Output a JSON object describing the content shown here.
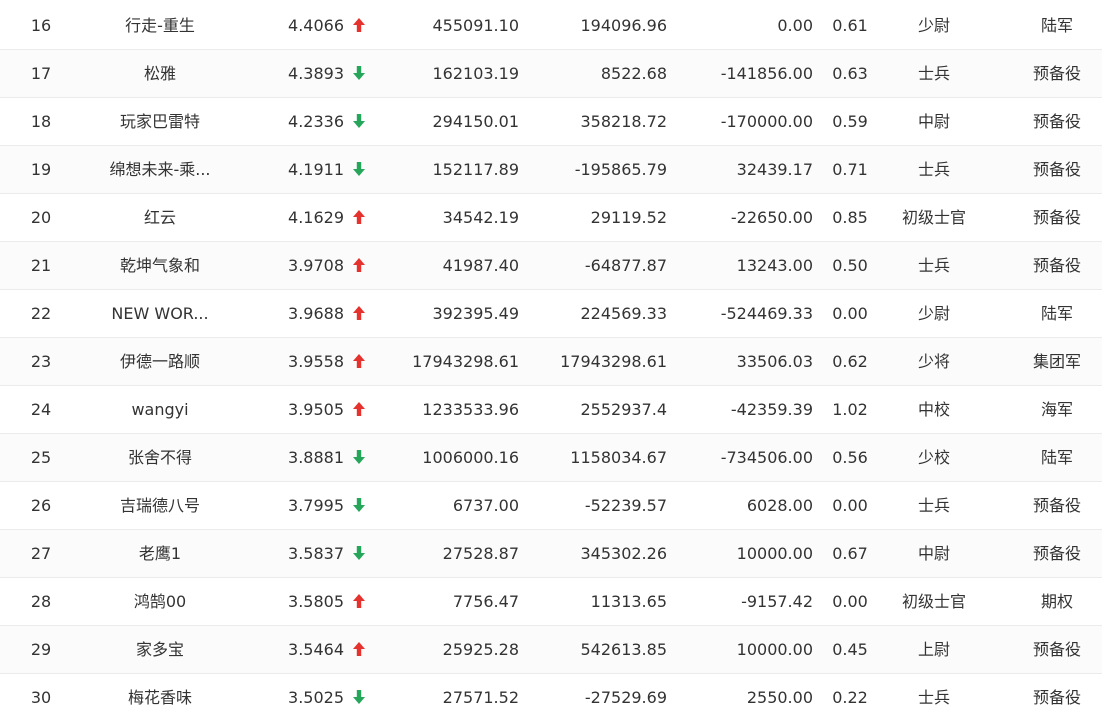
{
  "colors": {
    "up": "#e5322d",
    "down": "#26a65b"
  },
  "rows": [
    {
      "rank": "16",
      "name": "行走-重生",
      "score": "4.4066",
      "trend": "up",
      "v1": "455091.10",
      "v2": "194096.96",
      "v3": "0.00",
      "v4": "0.61",
      "title": "少尉",
      "branch": "陆军"
    },
    {
      "rank": "17",
      "name": "松雅",
      "score": "4.3893",
      "trend": "down",
      "v1": "162103.19",
      "v2": "8522.68",
      "v3": "-141856.00",
      "v4": "0.63",
      "title": "士兵",
      "branch": "预备役"
    },
    {
      "rank": "18",
      "name": "玩家巴雷特",
      "score": "4.2336",
      "trend": "down",
      "v1": "294150.01",
      "v2": "358218.72",
      "v3": "-170000.00",
      "v4": "0.59",
      "title": "中尉",
      "branch": "预备役"
    },
    {
      "rank": "19",
      "name": "绵想未来-乘...",
      "score": "4.1911",
      "trend": "down",
      "v1": "152117.89",
      "v2": "-195865.79",
      "v3": "32439.17",
      "v4": "0.71",
      "title": "士兵",
      "branch": "预备役"
    },
    {
      "rank": "20",
      "name": "红云",
      "score": "4.1629",
      "trend": "up",
      "v1": "34542.19",
      "v2": "29119.52",
      "v3": "-22650.00",
      "v4": "0.85",
      "title": "初级士官",
      "branch": "预备役"
    },
    {
      "rank": "21",
      "name": "乾坤气象和",
      "score": "3.9708",
      "trend": "up",
      "v1": "41987.40",
      "v2": "-64877.87",
      "v3": "13243.00",
      "v4": "0.50",
      "title": "士兵",
      "branch": "预备役"
    },
    {
      "rank": "22",
      "name": "NEW WOR...",
      "score": "3.9688",
      "trend": "up",
      "v1": "392395.49",
      "v2": "224569.33",
      "v3": "-524469.33",
      "v4": "0.00",
      "title": "少尉",
      "branch": "陆军"
    },
    {
      "rank": "23",
      "name": "伊德一路顺",
      "score": "3.9558",
      "trend": "up",
      "v1": "17943298.61",
      "v2": "17943298.61",
      "v3": "33506.03",
      "v4": "0.62",
      "title": "少将",
      "branch": "集团军"
    },
    {
      "rank": "24",
      "name": "wangyi",
      "score": "3.9505",
      "trend": "up",
      "v1": "1233533.96",
      "v2": "2552937.4",
      "v3": "-42359.39",
      "v4": "1.02",
      "title": "中校",
      "branch": "海军"
    },
    {
      "rank": "25",
      "name": "张舍不得",
      "score": "3.8881",
      "trend": "down",
      "v1": "1006000.16",
      "v2": "1158034.67",
      "v3": "-734506.00",
      "v4": "0.56",
      "title": "少校",
      "branch": "陆军"
    },
    {
      "rank": "26",
      "name": "吉瑞德八号",
      "score": "3.7995",
      "trend": "down",
      "v1": "6737.00",
      "v2": "-52239.57",
      "v3": "6028.00",
      "v4": "0.00",
      "title": "士兵",
      "branch": "预备役"
    },
    {
      "rank": "27",
      "name": "老鹰1",
      "score": "3.5837",
      "trend": "down",
      "v1": "27528.87",
      "v2": "345302.26",
      "v3": "10000.00",
      "v4": "0.67",
      "title": "中尉",
      "branch": "预备役"
    },
    {
      "rank": "28",
      "name": "鸿鹄00",
      "score": "3.5805",
      "trend": "up",
      "v1": "7756.47",
      "v2": "11313.65",
      "v3": "-9157.42",
      "v4": "0.00",
      "title": "初级士官",
      "branch": "期权"
    },
    {
      "rank": "29",
      "name": "家多宝",
      "score": "3.5464",
      "trend": "up",
      "v1": "25925.28",
      "v2": "542613.85",
      "v3": "10000.00",
      "v4": "0.45",
      "title": "上尉",
      "branch": "预备役"
    },
    {
      "rank": "30",
      "name": "梅花香味",
      "score": "3.5025",
      "trend": "down",
      "v1": "27571.52",
      "v2": "-27529.69",
      "v3": "2550.00",
      "v4": "0.22",
      "title": "士兵",
      "branch": "预备役"
    }
  ]
}
